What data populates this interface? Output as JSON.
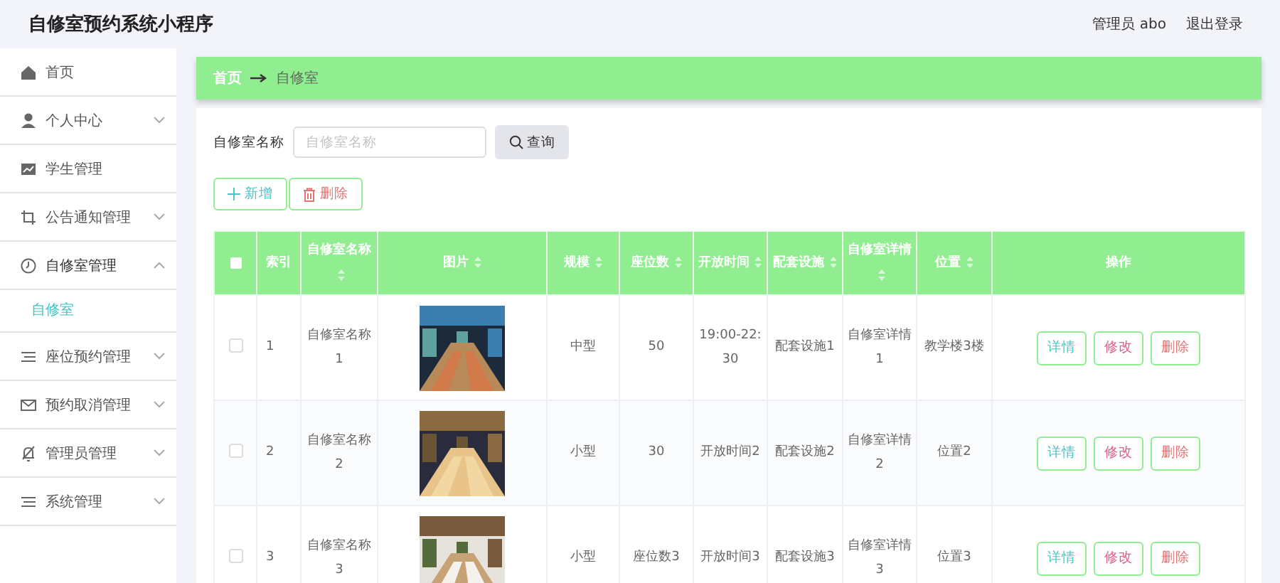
{
  "header": {
    "title": "自修室预约系统小程序",
    "user": "管理员 abo",
    "logout": "退出登录"
  },
  "sidebar": {
    "items": [
      {
        "label": "首页",
        "expandable": false
      },
      {
        "label": "个人中心",
        "expandable": true,
        "expanded": false
      },
      {
        "label": "学生管理",
        "expandable": false
      },
      {
        "label": "公告通知管理",
        "expandable": true,
        "expanded": false
      },
      {
        "label": "自修室管理",
        "expandable": true,
        "expanded": true,
        "children": [
          {
            "label": "自修室",
            "selected": true
          }
        ]
      },
      {
        "label": "座位预约管理",
        "expandable": true,
        "expanded": false
      },
      {
        "label": "预约取消管理",
        "expandable": true,
        "expanded": false
      },
      {
        "label": "管理员管理",
        "expandable": true,
        "expanded": false
      },
      {
        "label": "系统管理",
        "expandable": true,
        "expanded": false
      }
    ]
  },
  "breadcrumb": [
    "首页",
    "自修室"
  ],
  "search": {
    "label": "自修室名称",
    "placeholder": "自修室名称",
    "button": "查询"
  },
  "actions": [
    {
      "kind": "add",
      "label": "新增"
    },
    {
      "kind": "delete",
      "label": "删除"
    }
  ],
  "table": {
    "all_checked": false,
    "columns": [
      {
        "kind": "check"
      },
      {
        "label": "索引",
        "sortable": false
      },
      {
        "label": "自修室名称",
        "sortable": true
      },
      {
        "label": "图片",
        "sortable": true
      },
      {
        "label": "规模",
        "sortable": true
      },
      {
        "label": "座位数",
        "sortable": true
      },
      {
        "label": "开放时间",
        "sortable": true
      },
      {
        "label": "配套设施",
        "sortable": true
      },
      {
        "label": "自修室详情",
        "sortable": true
      },
      {
        "label": "位置",
        "sortable": true
      },
      {
        "label": "操作",
        "sortable": false
      }
    ],
    "rows": [
      {
        "checked": false,
        "index": "1",
        "name": "自修室名称1",
        "size": "中型",
        "seats": "50",
        "hours": "19:00-22:30",
        "facilities": "配套设施1",
        "details": "自修室详情1",
        "location": "教学楼3楼",
        "buttons": [
          {
            "kind": "detail",
            "label": "详情"
          },
          {
            "kind": "edit",
            "label": "修改"
          },
          {
            "kind": "delete",
            "label": "删除"
          }
        ]
      },
      {
        "checked": false,
        "index": "2",
        "name": "自修室名称2",
        "size": "小型",
        "seats": "30",
        "hours": "开放时间2",
        "facilities": "配套设施2",
        "details": "自修室详情2",
        "location": "位置2",
        "buttons": [
          {
            "kind": "detail",
            "label": "详情"
          },
          {
            "kind": "edit",
            "label": "修改"
          },
          {
            "kind": "delete",
            "label": "删除"
          }
        ]
      },
      {
        "checked": false,
        "index": "3",
        "name": "自修室名称3",
        "size": "小型",
        "seats": "座位数3",
        "hours": "开放时间3",
        "facilities": "配套设施3",
        "details": "自修室详情3",
        "location": "位置3",
        "buttons": [
          {
            "kind": "detail",
            "label": "详情"
          },
          {
            "kind": "edit",
            "label": "修改"
          },
          {
            "kind": "delete",
            "label": "删除"
          }
        ]
      }
    ]
  }
}
